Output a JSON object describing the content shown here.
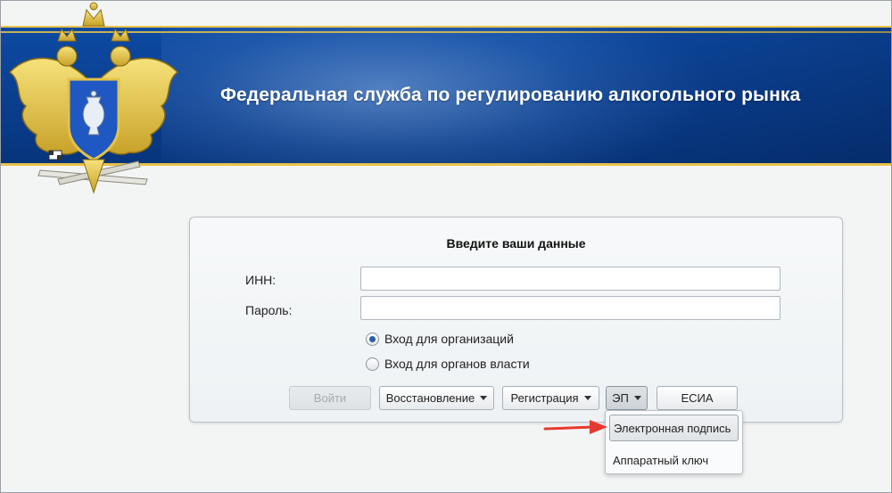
{
  "header": {
    "title": "Федеральная служба по регулированию алкогольного рынка",
    "emblem_icon": "double-headed-eagle-emblem-icon"
  },
  "login": {
    "heading": "Введите ваши данные",
    "inn_label": "ИНН:",
    "inn_value": "",
    "password_label": "Пароль:",
    "password_value": "",
    "radio_options": [
      {
        "label": "Вход для организаций",
        "checked": true
      },
      {
        "label": "Вход для органов власти",
        "checked": false
      }
    ],
    "buttons": {
      "login": "Войти",
      "recovery": "Восстановление",
      "registration": "Регистрация",
      "ep": "ЭП",
      "esia": "ЕСИА"
    }
  },
  "ep_menu": {
    "items": [
      "Электронная подпись",
      "Аппаратный ключ"
    ],
    "highlighted": 0
  },
  "colors": {
    "banner_blue": "#0a3e8e",
    "gold": "#e7c24a",
    "annotation_arrow": "#e53a2f"
  }
}
